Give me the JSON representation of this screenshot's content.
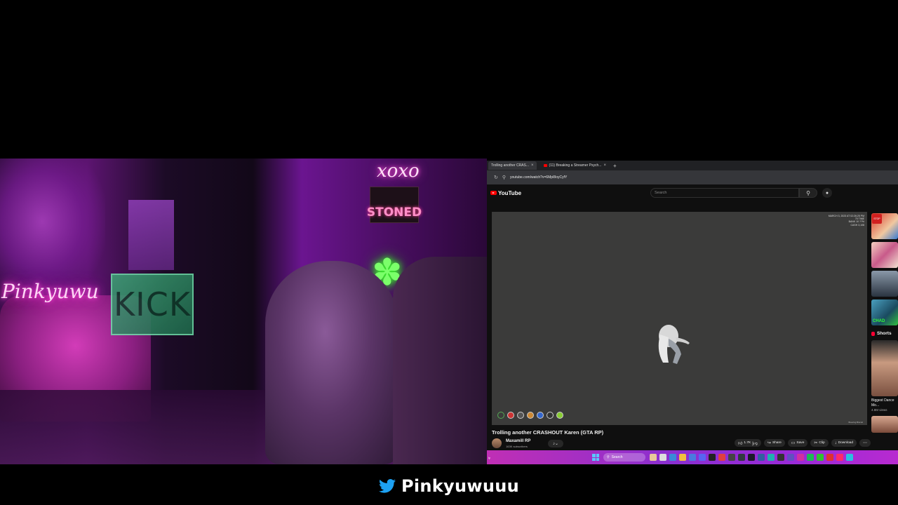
{
  "stream": {
    "webcam": {
      "neon_sign_left": "Pinkyuwu",
      "neon_sign_right": "xoxo",
      "stoned_sign": "STONED",
      "kick_sign": "KICK"
    },
    "social_handle": "Pinkyuwuuu",
    "social_icon": "twitter-bird-icon",
    "twitter_color": "#1DA1F2"
  },
  "browser": {
    "tabs": [
      {
        "label": "Trolling another CRAS...",
        "active": true
      },
      {
        "label": "(11) Breaking a Streamer Psych...",
        "active": false
      }
    ],
    "url": "youtube.com/watch?v=6MpI8oyCyfY"
  },
  "youtube": {
    "logo_text": "YouTube",
    "search_placeholder": "Search",
    "player_overlay": [
      "MARCH 3, 2023 AT 02:26:25 PM",
      "70 TIME",
      "BANK 10 ??%",
      "CASH 3,108"
    ],
    "watermark": "Brewing Biscuit",
    "video_title": "Trolling another CRASHOUT Karen (GTA RP)",
    "channel_name": "Maxamill RP",
    "subscribers": "163K subscribers",
    "actions": {
      "likes": "1.7K",
      "share": "Share",
      "save": "Save",
      "clip": "Clip",
      "download": "Download"
    },
    "sidebar": {
      "stop_badge": "STOP",
      "chad_badge": "CHAD",
      "shorts_label": "Shorts",
      "short_title": "Biggest Dance Mo...",
      "short_views": "4.8M views"
    }
  },
  "taskbar": {
    "left_text": "ly",
    "search_label": "Search"
  },
  "colors": {
    "youtube_red": "#FF0000",
    "taskbar_gradient": "#C02FB5",
    "neon_pink": "#FF3FD8",
    "neon_green": "#7BFF6A"
  }
}
